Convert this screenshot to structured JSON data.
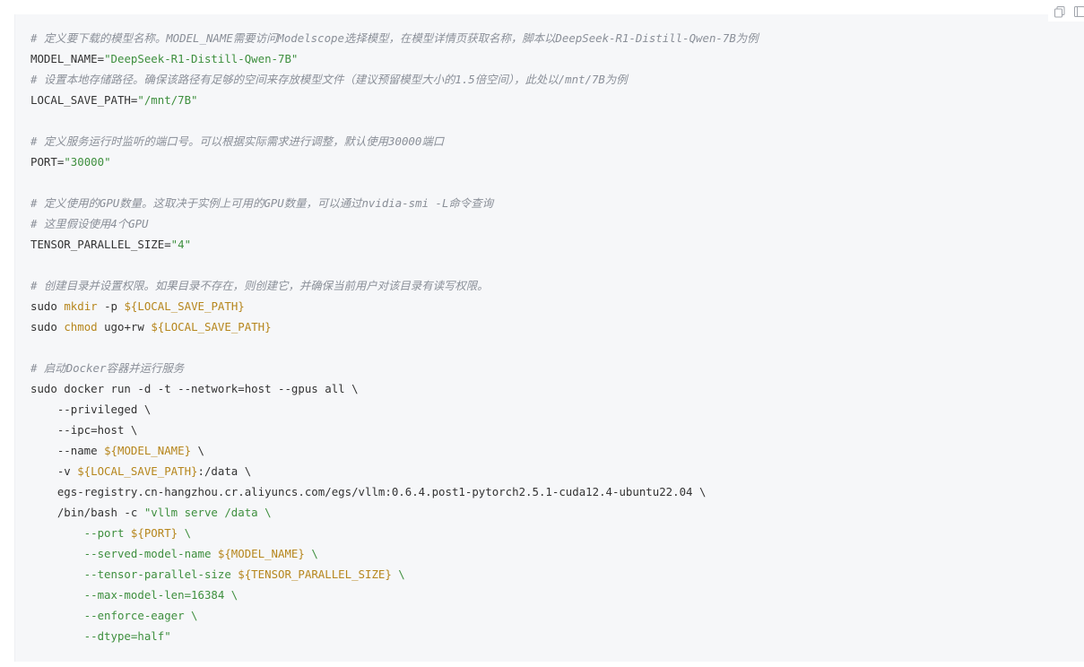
{
  "toolbar": {
    "copy_icon": "copy-icon",
    "expand_icon": "expand-icon"
  },
  "code": {
    "lines": [
      [
        {
          "t": "comment",
          "v": "# 定义要下载的模型名称。MODEL_NAME需要访问Modelscope选择模型，在模型详情页获取名称，脚本以DeepSeek-R1-Distill-Qwen-7B为例"
        }
      ],
      [
        {
          "t": "plain",
          "v": "MODEL_NAME="
        },
        {
          "t": "string",
          "v": "\"DeepSeek-R1-Distill-Qwen-7B\""
        }
      ],
      [
        {
          "t": "comment",
          "v": "# 设置本地存储路径。确保该路径有足够的空间来存放模型文件（建议预留模型大小的1.5倍空间），此处以/mnt/7B为例"
        }
      ],
      [
        {
          "t": "plain",
          "v": "LOCAL_SAVE_PATH="
        },
        {
          "t": "string",
          "v": "\"/mnt/7B\""
        }
      ],
      [],
      [
        {
          "t": "comment",
          "v": "# 定义服务运行时监听的端口号。可以根据实际需求进行调整，默认使用30000端口"
        }
      ],
      [
        {
          "t": "plain",
          "v": "PORT="
        },
        {
          "t": "string",
          "v": "\"30000\""
        }
      ],
      [],
      [
        {
          "t": "comment",
          "v": "# 定义使用的GPU数量。这取决于实例上可用的GPU数量，可以通过nvidia-smi -L命令查询"
        }
      ],
      [
        {
          "t": "comment",
          "v": "# 这里假设使用4个GPU"
        }
      ],
      [
        {
          "t": "plain",
          "v": "TENSOR_PARALLEL_SIZE="
        },
        {
          "t": "string",
          "v": "\"4\""
        }
      ],
      [],
      [
        {
          "t": "comment",
          "v": "# 创建目录并设置权限。如果目录不存在，则创建它，并确保当前用户对该目录有读写权限。"
        }
      ],
      [
        {
          "t": "plain",
          "v": "sudo "
        },
        {
          "t": "cmd",
          "v": "mkdir"
        },
        {
          "t": "plain",
          "v": " -p "
        },
        {
          "t": "var",
          "v": "${LOCAL_SAVE_PATH}"
        }
      ],
      [
        {
          "t": "plain",
          "v": "sudo "
        },
        {
          "t": "cmd",
          "v": "chmod"
        },
        {
          "t": "plain",
          "v": " ugo+rw "
        },
        {
          "t": "var",
          "v": "${LOCAL_SAVE_PATH}"
        }
      ],
      [],
      [
        {
          "t": "comment",
          "v": "# 启动Docker容器并运行服务"
        }
      ],
      [
        {
          "t": "plain",
          "v": "sudo docker run -d -t --network=host --gpus all \\"
        }
      ],
      [
        {
          "t": "plain",
          "v": "    --privileged \\"
        }
      ],
      [
        {
          "t": "plain",
          "v": "    --ipc=host \\"
        }
      ],
      [
        {
          "t": "plain",
          "v": "    --name "
        },
        {
          "t": "var",
          "v": "${MODEL_NAME}"
        },
        {
          "t": "plain",
          "v": " \\"
        }
      ],
      [
        {
          "t": "plain",
          "v": "    -v "
        },
        {
          "t": "var",
          "v": "${LOCAL_SAVE_PATH}"
        },
        {
          "t": "plain",
          "v": ":/data \\"
        }
      ],
      [
        {
          "t": "plain",
          "v": "    egs-registry.cn-hangzhou.cr.aliyuncs.com/egs/vllm:0.6.4.post1-pytorch2.5.1-cuda12.4-ubuntu22.04 \\"
        }
      ],
      [
        {
          "t": "plain",
          "v": "    /bin/bash -c "
        },
        {
          "t": "string",
          "v": "\"vllm serve /data \\"
        }
      ],
      [
        {
          "t": "string",
          "v": "        --port "
        },
        {
          "t": "var",
          "v": "${PORT}"
        },
        {
          "t": "string",
          "v": " \\"
        }
      ],
      [
        {
          "t": "string",
          "v": "        --served-model-name "
        },
        {
          "t": "var",
          "v": "${MODEL_NAME}"
        },
        {
          "t": "string",
          "v": " \\"
        }
      ],
      [
        {
          "t": "string",
          "v": "        --tensor-parallel-size "
        },
        {
          "t": "var",
          "v": "${TENSOR_PARALLEL_SIZE}"
        },
        {
          "t": "string",
          "v": " \\"
        }
      ],
      [
        {
          "t": "string",
          "v": "        --max-model-len=16384 \\"
        }
      ],
      [
        {
          "t": "string",
          "v": "        --enforce-eager \\"
        }
      ],
      [
        {
          "t": "string",
          "v": "        --dtype=half\""
        }
      ]
    ]
  }
}
